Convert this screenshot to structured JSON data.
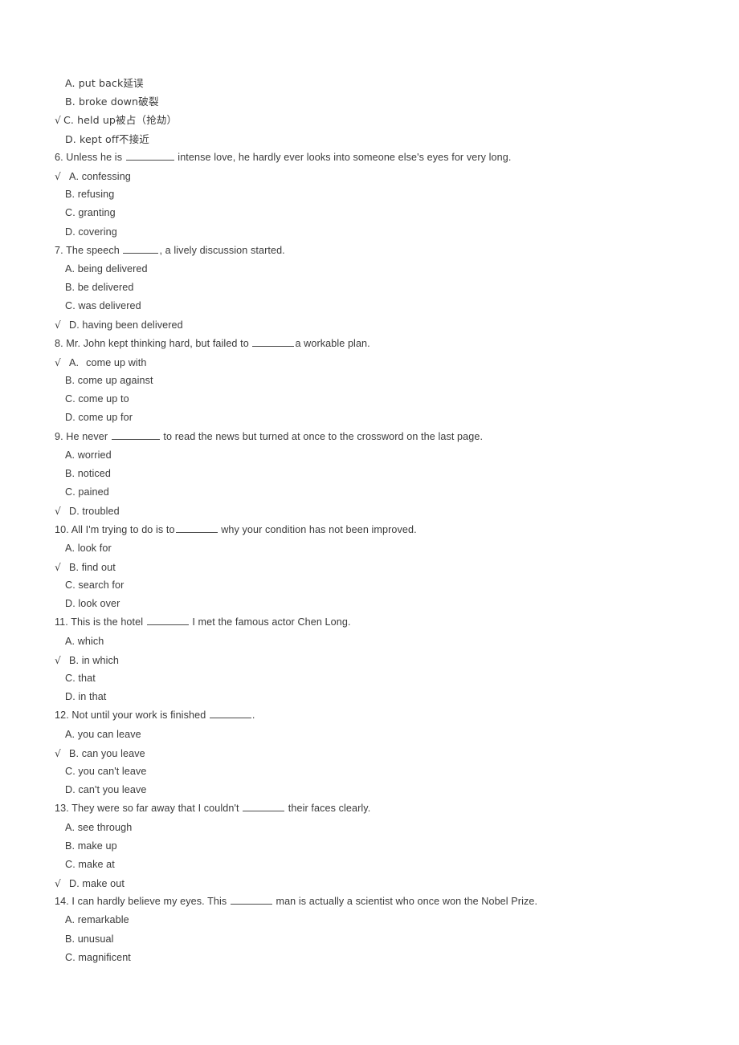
{
  "document": {
    "type": "multiple-choice-exam-page",
    "language": "en-zh",
    "check_mark": "√"
  },
  "lines": [
    {
      "kind": "option",
      "checked": false,
      "tick_style": "none",
      "text": "A. put back延误"
    },
    {
      "kind": "option",
      "checked": false,
      "tick_style": "none",
      "text": "B. broke down破裂"
    },
    {
      "kind": "option",
      "checked": true,
      "tick_style": "tight",
      "text": "C. held up被占（抢劫）"
    },
    {
      "kind": "option",
      "checked": false,
      "tick_style": "none",
      "text": "D. kept off不接近"
    },
    {
      "kind": "question",
      "checked": false,
      "tick_style": "none",
      "parts": [
        {
          "t": "text",
          "v": "6. Unless he is "
        },
        {
          "t": "blank",
          "w": "b7"
        },
        {
          "t": "text",
          "v": " intense love, he hardly ever looks into someone else's eyes for very long."
        }
      ]
    },
    {
      "kind": "option",
      "checked": true,
      "tick_style": "spaced",
      "text": "A. confessing"
    },
    {
      "kind": "option",
      "checked": false,
      "tick_style": "none",
      "text": "B. refusing"
    },
    {
      "kind": "option",
      "checked": false,
      "tick_style": "none",
      "text": "C. granting"
    },
    {
      "kind": "option",
      "checked": false,
      "tick_style": "none",
      "text": "D. covering"
    },
    {
      "kind": "question",
      "checked": false,
      "tick_style": "none",
      "parts": [
        {
          "t": "text",
          "v": "7. The speech "
        },
        {
          "t": "blank",
          "w": "b5"
        },
        {
          "t": "text",
          "v": ", a lively discussion started."
        }
      ]
    },
    {
      "kind": "option",
      "checked": false,
      "tick_style": "none",
      "text": "A. being delivered"
    },
    {
      "kind": "option",
      "checked": false,
      "tick_style": "none",
      "text": "B. be delivered"
    },
    {
      "kind": "option",
      "checked": false,
      "tick_style": "none",
      "text": "C. was delivered"
    },
    {
      "kind": "option",
      "checked": true,
      "tick_style": "spaced",
      "text": "D. having been delivered"
    },
    {
      "kind": "question",
      "checked": false,
      "tick_style": "none",
      "parts": [
        {
          "t": "text",
          "v": "8. Mr. John kept thinking hard, but failed to "
        },
        {
          "t": "blank",
          "w": "b6"
        },
        {
          "t": "text",
          "v": "a workable plan."
        }
      ]
    },
    {
      "kind": "option",
      "checked": true,
      "tick_style": "spaced",
      "text": "A.",
      "text_after_gap": "come up with"
    },
    {
      "kind": "option",
      "checked": false,
      "tick_style": "none",
      "text": "B. come up against"
    },
    {
      "kind": "option",
      "checked": false,
      "tick_style": "none",
      "text": "C. come up to"
    },
    {
      "kind": "option",
      "checked": false,
      "tick_style": "none",
      "text": "D. come up for"
    },
    {
      "kind": "question",
      "checked": false,
      "tick_style": "none",
      "parts": [
        {
          "t": "text",
          "v": "9. He never "
        },
        {
          "t": "blank",
          "w": "b7"
        },
        {
          "t": "text",
          "v": " to read the news but turned at once to the crossword on the last page."
        }
      ]
    },
    {
      "kind": "option",
      "checked": false,
      "tick_style": "none",
      "text": "A. worried"
    },
    {
      "kind": "option",
      "checked": false,
      "tick_style": "none",
      "text": "B. noticed"
    },
    {
      "kind": "option",
      "checked": false,
      "tick_style": "none",
      "text": "C. pained"
    },
    {
      "kind": "option",
      "checked": true,
      "tick_style": "spaced",
      "text": "D. troubled"
    },
    {
      "kind": "question",
      "checked": false,
      "tick_style": "none",
      "parts": [
        {
          "t": "text",
          "v": "10. All I'm trying to do is to"
        },
        {
          "t": "blank",
          "w": "b6"
        },
        {
          "t": "text",
          "v": " why your condition has not been improved."
        }
      ]
    },
    {
      "kind": "option",
      "checked": false,
      "tick_style": "none",
      "text": "A. look for"
    },
    {
      "kind": "option",
      "checked": true,
      "tick_style": "spaced",
      "text": "B. find out"
    },
    {
      "kind": "option",
      "checked": false,
      "tick_style": "none",
      "text": "C. search for"
    },
    {
      "kind": "option",
      "checked": false,
      "tick_style": "none",
      "text": "D. look over"
    },
    {
      "kind": "question",
      "checked": false,
      "tick_style": "none",
      "parts": [
        {
          "t": "text",
          "v": "11. This is the hotel "
        },
        {
          "t": "blank",
          "w": "b6"
        },
        {
          "t": "text",
          "v": " I met the famous actor Chen Long."
        }
      ]
    },
    {
      "kind": "option",
      "checked": false,
      "tick_style": "none",
      "text": "A. which"
    },
    {
      "kind": "option",
      "checked": true,
      "tick_style": "spaced",
      "text": "B. in which"
    },
    {
      "kind": "option",
      "checked": false,
      "tick_style": "none",
      "text": "C. that"
    },
    {
      "kind": "option",
      "checked": false,
      "tick_style": "none",
      "text": "D. in that"
    },
    {
      "kind": "question",
      "checked": false,
      "tick_style": "none",
      "parts": [
        {
          "t": "text",
          "v": "12. Not until your work is finished "
        },
        {
          "t": "blank",
          "w": "b6"
        },
        {
          "t": "text",
          "v": "."
        }
      ]
    },
    {
      "kind": "option",
      "checked": false,
      "tick_style": "none",
      "text": "A. you can leave"
    },
    {
      "kind": "option",
      "checked": true,
      "tick_style": "spaced",
      "text": "B. can you leave"
    },
    {
      "kind": "option",
      "checked": false,
      "tick_style": "none",
      "text": "C. you can't leave"
    },
    {
      "kind": "option",
      "checked": false,
      "tick_style": "none",
      "text": "D. can't you leave"
    },
    {
      "kind": "question",
      "checked": false,
      "tick_style": "none",
      "parts": [
        {
          "t": "text",
          "v": "13. They were so far away that I couldn't "
        },
        {
          "t": "blank",
          "w": "b6"
        },
        {
          "t": "text",
          "v": " their faces clearly."
        }
      ]
    },
    {
      "kind": "option",
      "checked": false,
      "tick_style": "none",
      "text": "A. see through"
    },
    {
      "kind": "option",
      "checked": false,
      "tick_style": "none",
      "text": "B. make up"
    },
    {
      "kind": "option",
      "checked": false,
      "tick_style": "none",
      "text": "C. make at"
    },
    {
      "kind": "option",
      "checked": true,
      "tick_style": "spaced",
      "text": "D. make out"
    },
    {
      "kind": "question",
      "checked": false,
      "tick_style": "none",
      "parts": [
        {
          "t": "text",
          "v": "14. I can hardly believe my eyes. This "
        },
        {
          "t": "blank",
          "w": "b6"
        },
        {
          "t": "text",
          "v": " man is actually a scientist who once won the Nobel Prize."
        }
      ]
    },
    {
      "kind": "option",
      "checked": false,
      "tick_style": "none",
      "text": "A. remarkable"
    },
    {
      "kind": "option",
      "checked": false,
      "tick_style": "none",
      "text": "B. unusual"
    },
    {
      "kind": "option",
      "checked": false,
      "tick_style": "none",
      "text": "C. magnificent"
    }
  ]
}
